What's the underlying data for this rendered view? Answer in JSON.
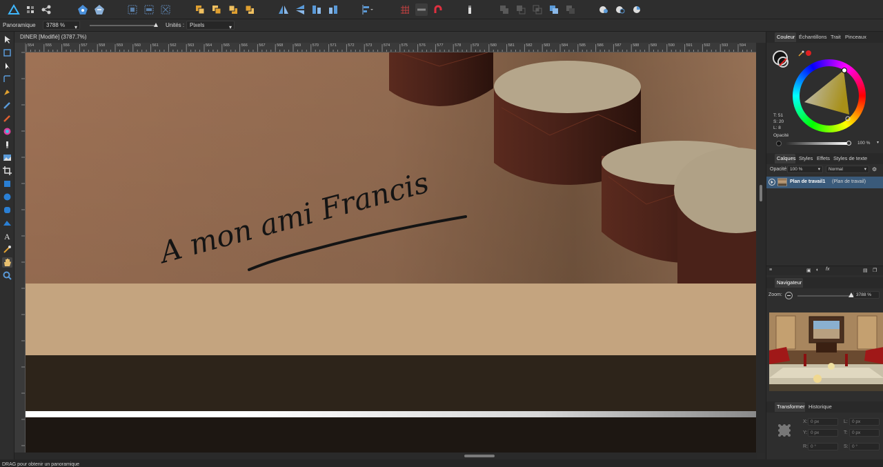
{
  "app": {
    "name": "Affinity Designer",
    "document_tab": "DINER [Modifié] (3787.7%)"
  },
  "context_bar": {
    "tool_name": "Panoramique",
    "zoom_value": "3788 %",
    "units_label": "Unités :",
    "units_value": "Pixels"
  },
  "toolbar_icons": [
    "persona-designer-icon",
    "persona-pixel-icon",
    "persona-export-icon",
    "assistant-icon",
    "snapping-icon",
    "transform-icon",
    "align-icon",
    "arrange-back-icon",
    "arrange-backward-icon",
    "arrange-forward-icon",
    "arrange-front-icon",
    "flip-horizontal-icon",
    "flip-vertical-icon",
    "rotate-left-icon",
    "rotate-right-icon",
    "alignment-icon",
    "grid-icon",
    "snap-icon",
    "magnet-icon",
    "insert-icon",
    "boolean-add-icon",
    "boolean-subtract-icon",
    "boolean-intersect-icon",
    "boolean-xor-icon",
    "boolean-divide-icon",
    "boolean-combine-icon",
    "geometry-icon",
    "clip-icon"
  ],
  "ruler": {
    "h_labels": [
      "554",
      "555",
      "556",
      "557",
      "558",
      "559",
      "560",
      "561",
      "562",
      "563",
      "564",
      "565",
      "566",
      "567",
      "568",
      "569",
      "570",
      "571",
      "572",
      "573",
      "574",
      "575",
      "576",
      "577",
      "578",
      "579",
      "580",
      "581",
      "582",
      "583",
      "584",
      "585",
      "586",
      "587",
      "588",
      "589",
      "590",
      "591",
      "592",
      "593",
      "594"
    ]
  },
  "canvas": {
    "handwriting": "A mon ami Francis"
  },
  "color_panel": {
    "tabs": [
      "Couleur",
      "Échantillons",
      "Trait",
      "Pinceaux"
    ],
    "active_tab": "Couleur",
    "t_value": "T: 51",
    "s_value": "S: 20",
    "l_value": "L: 8",
    "opacity_label": "Opacité",
    "opacity_value": "100 %"
  },
  "layers_panel": {
    "tabs": [
      "Calques",
      "Styles",
      "Effets",
      "Styles de texte"
    ],
    "active_tab": "Calques",
    "opacity_label": "Opacité:",
    "opacity_value": "100 %",
    "blend_mode": "Normal",
    "layer_name": "Plan de travail1",
    "layer_type": "(Plan de travail)"
  },
  "navigator_panel": {
    "tab": "Navigateur",
    "zoom_label": "Zoom:",
    "zoom_value": "3788 %"
  },
  "transform_panel": {
    "tabs": [
      "Transformer",
      "Historique"
    ],
    "active_tab": "Transformer",
    "fields": [
      {
        "label": "X:",
        "value": "0 px"
      },
      {
        "label": "L:",
        "value": "0 px"
      },
      {
        "label": "Y:",
        "value": "0 px"
      },
      {
        "label": "T:",
        "value": "0 px"
      },
      {
        "label": "R:",
        "value": "0 °"
      },
      {
        "label": "S:",
        "value": "0 °"
      }
    ]
  },
  "status": {
    "text": "DRAG pour obtenir un panoramique"
  },
  "colors": {
    "accent": "#3f8fd6",
    "selected_layer_bg": "#3a5a7a",
    "canvas_wall": "#a57a59",
    "canvas_table": "#c4a47f",
    "canvas_dark": "#2b2218"
  }
}
